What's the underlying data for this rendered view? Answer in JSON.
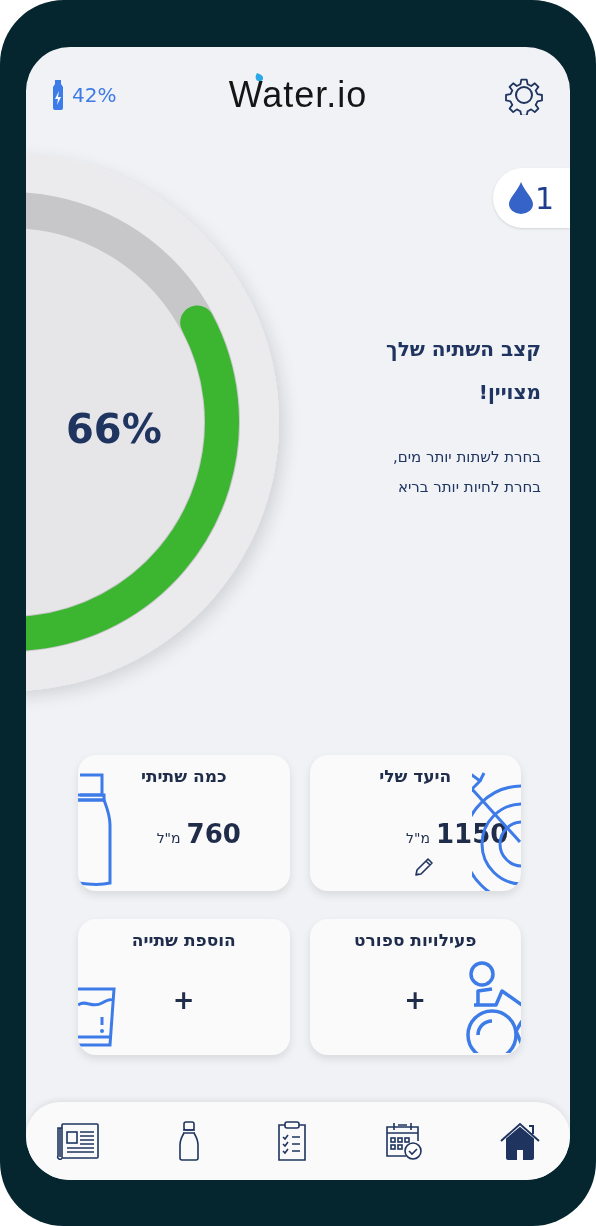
{
  "header": {
    "bottle_battery": "42%",
    "logo": "Water.io"
  },
  "reminder_badge": {
    "count": "1"
  },
  "gauge": {
    "percent": "66%"
  },
  "message": {
    "headline": "קצב השתיה שלך\nמצויין!",
    "text": "בחרת לשתות יותר מים,\nבחרת לחיות יותר בריא"
  },
  "cards": [
    {
      "kind": "goal",
      "title": "היעד שלי",
      "value": "1150",
      "unit": "מ\"ל"
    },
    {
      "kind": "drunk",
      "title": "כמה שתיתי",
      "value": "760",
      "unit": "מ\"ל"
    },
    {
      "kind": "sport",
      "title": "פעילויות ספורט",
      "action": "+"
    },
    {
      "kind": "add_drink",
      "title": "הוספת שתייה",
      "action": "+"
    }
  ],
  "nav": [
    {
      "kind": "news",
      "selected": false
    },
    {
      "kind": "bottle",
      "selected": false
    },
    {
      "kind": "checklist",
      "selected": false
    },
    {
      "kind": "calendar",
      "selected": false
    },
    {
      "kind": "home",
      "selected": true
    }
  ]
}
